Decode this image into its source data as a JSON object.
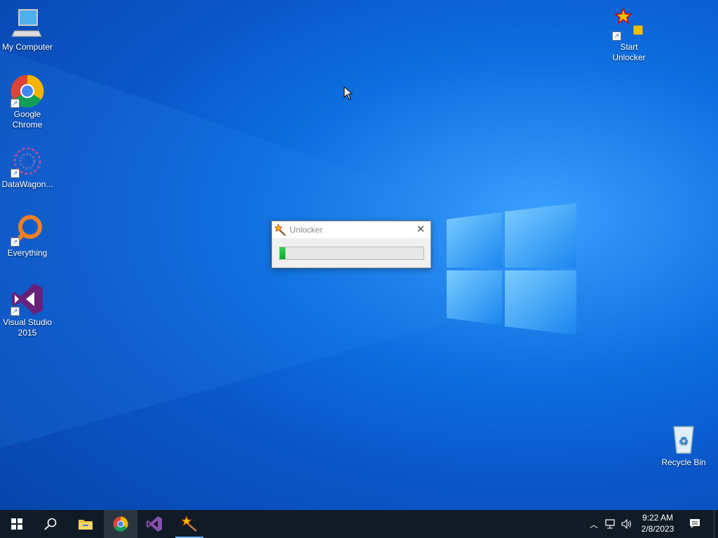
{
  "desktop": {
    "icons": [
      {
        "label": "My Computer"
      },
      {
        "label": "Google Chrome"
      },
      {
        "label": "DataWagon..."
      },
      {
        "label": "Everything"
      },
      {
        "label": "Visual Studio 2015"
      },
      {
        "label": "Start Unlocker"
      },
      {
        "label": "Recycle Bin"
      }
    ]
  },
  "dialog": {
    "title": "Unlocker",
    "progress_percent": 4
  },
  "taskbar": {
    "apps": [
      {
        "name": "start-button"
      },
      {
        "name": "search"
      },
      {
        "name": "file-explorer"
      },
      {
        "name": "google-chrome"
      },
      {
        "name": "visual-studio"
      },
      {
        "name": "unlocker"
      }
    ],
    "clock": {
      "time": "9:22 AM",
      "date": "2/8/2023"
    }
  },
  "colors": {
    "desktop_bg": "#0a56c9",
    "taskbar_bg": "#101b26",
    "progress_fill": "#0fa82a"
  }
}
